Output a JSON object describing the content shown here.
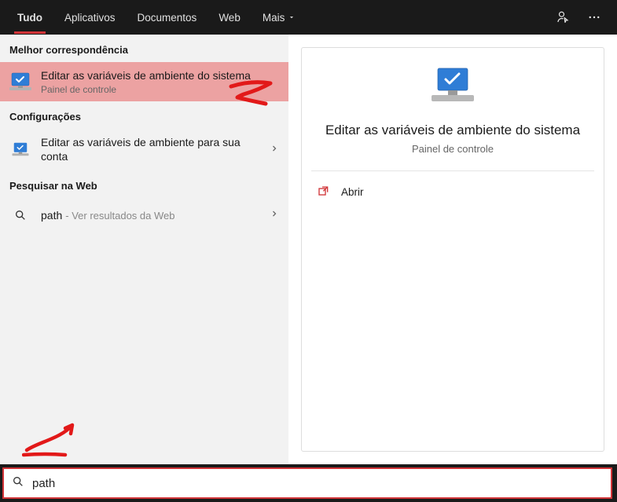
{
  "header": {
    "tabs": [
      {
        "label": "Tudo",
        "active": true
      },
      {
        "label": "Aplicativos",
        "active": false
      },
      {
        "label": "Documentos",
        "active": false
      },
      {
        "label": "Web",
        "active": false
      }
    ],
    "more_label": "Mais"
  },
  "left": {
    "best_match_header": "Melhor correspondência",
    "best_match": {
      "title": "Editar as variáveis de ambiente do sistema",
      "subtitle": "Painel de controle"
    },
    "settings_header": "Configurações",
    "settings_item": {
      "title": "Editar as variáveis de ambiente para sua conta"
    },
    "web_header": "Pesquisar na Web",
    "web_item": {
      "term": "path",
      "hint": "- Ver resultados da Web"
    }
  },
  "preview": {
    "title": "Editar as variáveis de ambiente do sistema",
    "subtitle": "Painel de controle",
    "open_label": "Abrir"
  },
  "search": {
    "value": "path"
  }
}
